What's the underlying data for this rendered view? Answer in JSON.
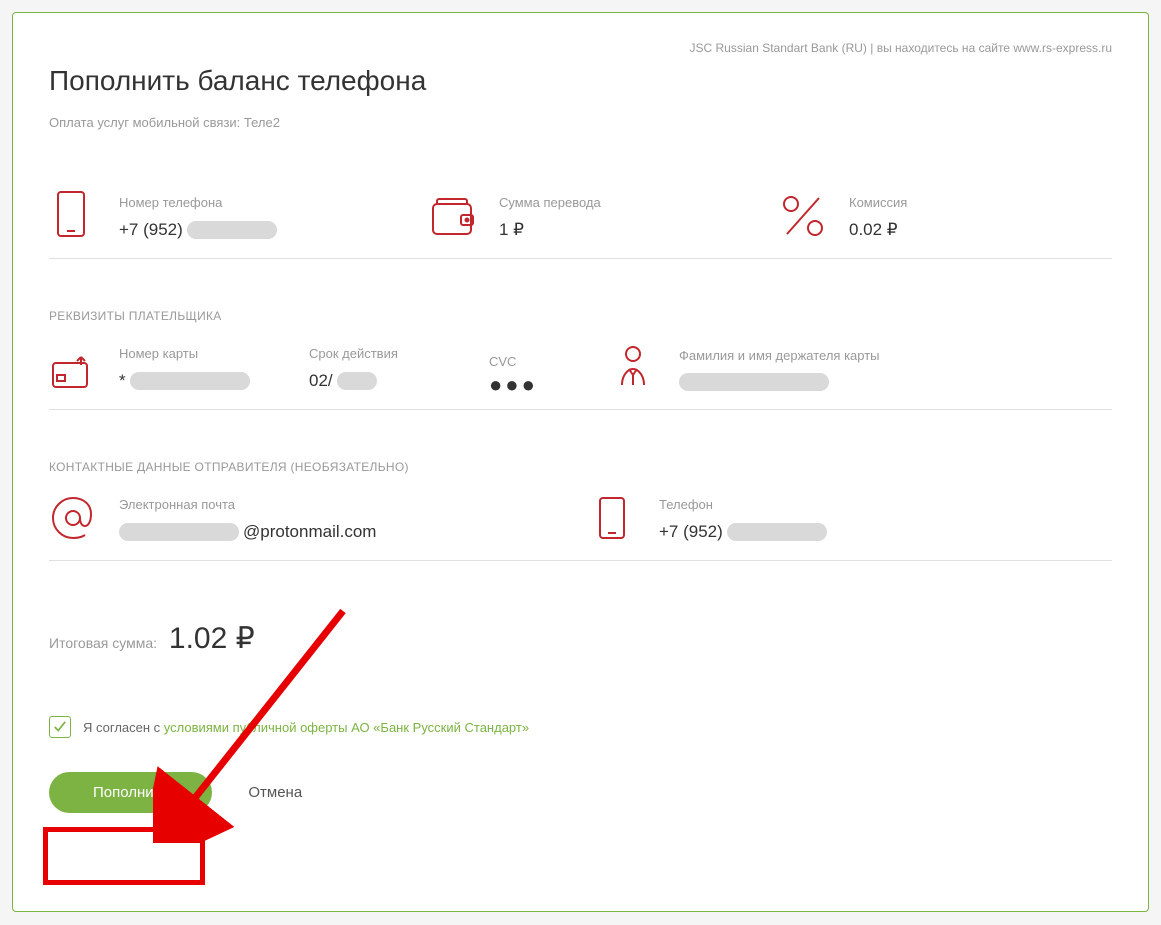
{
  "top_note": "JSC Russian Standart Bank (RU) | вы находитесь на сайте www.rs-express.ru",
  "title": "Пополнить баланс телефона",
  "subtitle": "Оплата услуг мобильной связи: Теле2",
  "payment": {
    "phone_label": "Номер телефона",
    "phone_value_prefix": "+7 (952)",
    "amount_label": "Сумма перевода",
    "amount_value": "1 ₽",
    "fee_label": "Комиссия",
    "fee_value": "0.02 ₽"
  },
  "payer": {
    "section": "РЕКВИЗИТЫ ПЛАТЕЛЬЩИКА",
    "card_label": "Номер карты",
    "card_prefix": "*",
    "expiry_label": "Срок действия",
    "expiry_prefix": "02/",
    "cvc_label": "CVC",
    "cvc_value": "●●●",
    "holder_label": "Фамилия и имя держателя карты"
  },
  "contact": {
    "section": "КОНТАКТНЫЕ ДАННЫЕ ОТПРАВИТЕЛЯ (НЕОБЯЗАТЕЛЬНО)",
    "email_label": "Электронная почта",
    "email_suffix": "@protonmail.com",
    "phone_label": "Телефон",
    "phone_prefix": "+7 (952)"
  },
  "total_label": "Итоговая сумма:",
  "total_value": "1.02 ₽",
  "agree_prefix": "Я согласен с ",
  "agree_link": "условиями публичной оферты АО «Банк Русский Стандарт»",
  "submit": "Пополнить",
  "cancel": "Отмена"
}
